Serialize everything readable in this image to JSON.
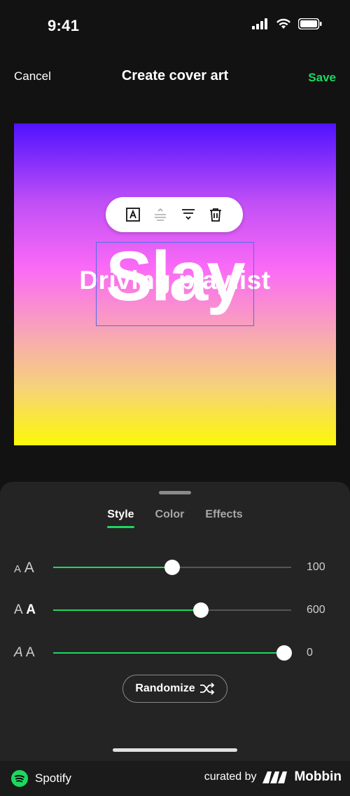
{
  "status_bar": {
    "time": "9:41"
  },
  "nav": {
    "cancel": "Cancel",
    "title": "Create cover art",
    "save": "Save"
  },
  "canvas": {
    "title_text": "Slay",
    "subtitle_text": "Driving playlist"
  },
  "text_toolbar": {
    "icons": [
      "text-style-icon",
      "align-center-icon",
      "align-bottom-icon",
      "trash-icon"
    ]
  },
  "tabs": [
    {
      "label": "Style",
      "active": true
    },
    {
      "label": "Color",
      "active": false
    },
    {
      "label": "Effects",
      "active": false
    }
  ],
  "sliders": [
    {
      "name": "font-size",
      "icon_text": "A A",
      "value_label": "100",
      "fill_fraction": 0.5
    },
    {
      "name": "font-weight",
      "icon_text": "A A",
      "value_label": "600",
      "fill_fraction": 0.62
    },
    {
      "name": "italic-slant",
      "icon_text": "A A",
      "value_label": "0",
      "fill_fraction": 0.97
    }
  ],
  "randomize_label": "Randomize",
  "footer": {
    "brand": "Spotify",
    "curated_by": "curated by",
    "curator": "Mobbin"
  },
  "colors": {
    "accent": "#1ed760",
    "background": "#121212",
    "sheet": "#242424"
  }
}
